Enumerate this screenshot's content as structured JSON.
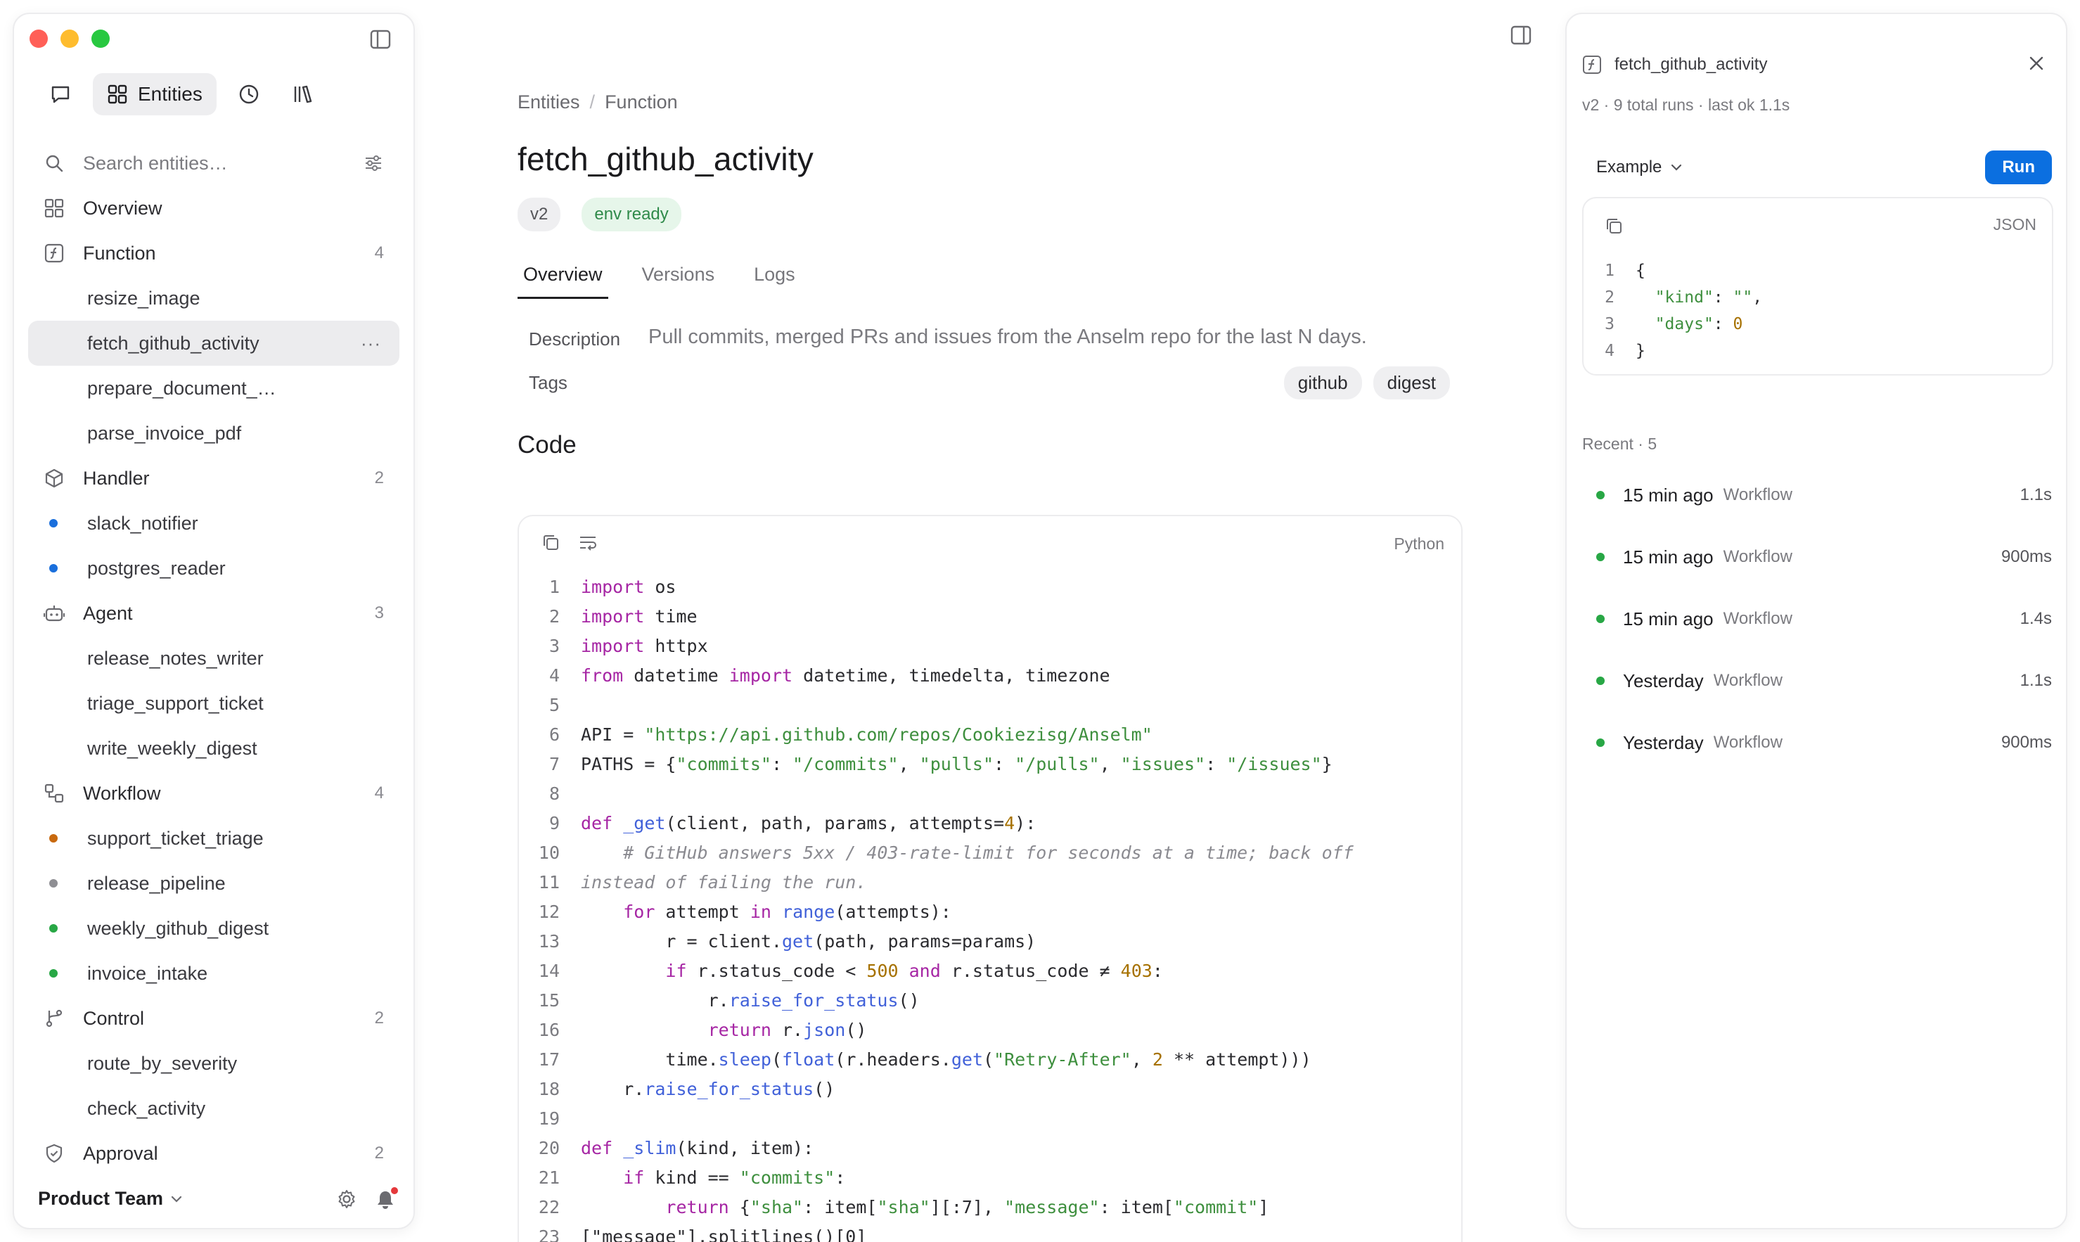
{
  "sidebar": {
    "mode_active_label": "Entities",
    "search_placeholder": "Search entities…",
    "overview_label": "Overview",
    "groups": [
      {
        "label": "Function",
        "count": "4",
        "icon": "function-icon",
        "items": [
          {
            "label": "resize_image"
          },
          {
            "label": "fetch_github_activity",
            "selected": true,
            "more": "···"
          },
          {
            "label": "prepare_document_…"
          },
          {
            "label": "parse_invoice_pdf"
          }
        ]
      },
      {
        "label": "Handler",
        "count": "2",
        "icon": "cube-icon",
        "items": [
          {
            "label": "slack_notifier",
            "dot": "#1a6fdc"
          },
          {
            "label": "postgres_reader",
            "dot": "#1a6fdc"
          }
        ]
      },
      {
        "label": "Agent",
        "count": "3",
        "icon": "bot-icon",
        "items": [
          {
            "label": "release_notes_writer"
          },
          {
            "label": "triage_support_ticket"
          },
          {
            "label": "write_weekly_digest"
          }
        ]
      },
      {
        "label": "Workflow",
        "count": "4",
        "icon": "workflow-icon",
        "items": [
          {
            "label": "support_ticket_triage",
            "dot": "#c8690f"
          },
          {
            "label": "release_pipeline",
            "dot": "#8e8e93"
          },
          {
            "label": "weekly_github_digest",
            "dot": "#28a745"
          },
          {
            "label": "invoice_intake",
            "dot": "#28a745"
          }
        ]
      },
      {
        "label": "Control",
        "count": "2",
        "icon": "branch-icon",
        "items": [
          {
            "label": "route_by_severity"
          },
          {
            "label": "check_activity"
          }
        ]
      },
      {
        "label": "Approval",
        "count": "2",
        "icon": "shield-check-icon",
        "items": []
      }
    ],
    "team_label": "Product Team"
  },
  "main": {
    "breadcrumb": [
      "Entities",
      "Function"
    ],
    "title": "fetch_github_activity",
    "badges": {
      "version": "v2",
      "env": "env ready"
    },
    "tabs": [
      "Overview",
      "Versions",
      "Logs"
    ],
    "description_label": "Description",
    "description": "Pull commits, merged PRs and issues from the Anselm repo for the last N days.",
    "tags_label": "Tags",
    "tags": [
      "github",
      "digest"
    ],
    "code_heading": "Code",
    "code_language": "Python",
    "code_lines": [
      [
        [
          "kw",
          "import"
        ],
        [
          "tx",
          " os"
        ]
      ],
      [
        [
          "kw",
          "import"
        ],
        [
          "tx",
          " time"
        ]
      ],
      [
        [
          "kw",
          "import"
        ],
        [
          "tx",
          " httpx"
        ]
      ],
      [
        [
          "kw",
          "from"
        ],
        [
          "tx",
          " datetime "
        ],
        [
          "kw",
          "import"
        ],
        [
          "tx",
          " datetime, timedelta, timezone"
        ]
      ],
      [],
      [
        [
          "tx",
          "API = "
        ],
        [
          "st",
          "\"https://api.github.com/repos/Cookiezisg/Anselm\""
        ]
      ],
      [
        [
          "tx",
          "PATHS = {"
        ],
        [
          "st",
          "\"commits\""
        ],
        [
          "tx",
          ": "
        ],
        [
          "st",
          "\"/commits\""
        ],
        [
          "tx",
          ", "
        ],
        [
          "st",
          "\"pulls\""
        ],
        [
          "tx",
          ": "
        ],
        [
          "st",
          "\"/pulls\""
        ],
        [
          "tx",
          ", "
        ],
        [
          "st",
          "\"issues\""
        ],
        [
          "tx",
          ": "
        ],
        [
          "st",
          "\"/issues\""
        ],
        [
          "tx",
          "}"
        ]
      ],
      [],
      [
        [
          "kw",
          "def"
        ],
        [
          "tx",
          " "
        ],
        [
          "fn",
          "_get"
        ],
        [
          "tx",
          "(client, path, params, attempts="
        ],
        [
          "nm",
          "4"
        ],
        [
          "tx",
          "):"
        ]
      ],
      [
        [
          "cm",
          "    # GitHub answers 5xx / 403-rate-limit for seconds at a time; back off"
        ]
      ],
      [
        [
          "cm",
          "instead of failing the run."
        ]
      ],
      [
        [
          "tx",
          "    "
        ],
        [
          "kw",
          "for"
        ],
        [
          "tx",
          " attempt "
        ],
        [
          "kw",
          "in"
        ],
        [
          "tx",
          " "
        ],
        [
          "fn",
          "range"
        ],
        [
          "tx",
          "(attempts):"
        ]
      ],
      [
        [
          "tx",
          "        r = client."
        ],
        [
          "fn",
          "get"
        ],
        [
          "tx",
          "(path, params=params)"
        ]
      ],
      [
        [
          "tx",
          "        "
        ],
        [
          "kw",
          "if"
        ],
        [
          "tx",
          " r.status_code < "
        ],
        [
          "nm",
          "500"
        ],
        [
          "tx",
          " "
        ],
        [
          "kw",
          "and"
        ],
        [
          "tx",
          " r.status_code ≠ "
        ],
        [
          "nm",
          "403"
        ],
        [
          "tx",
          ":"
        ]
      ],
      [
        [
          "tx",
          "            r."
        ],
        [
          "fn",
          "raise_for_status"
        ],
        [
          "tx",
          "()"
        ]
      ],
      [
        [
          "tx",
          "            "
        ],
        [
          "kw",
          "return"
        ],
        [
          "tx",
          " r."
        ],
        [
          "fn",
          "json"
        ],
        [
          "tx",
          "()"
        ]
      ],
      [
        [
          "tx",
          "        time."
        ],
        [
          "fn",
          "sleep"
        ],
        [
          "tx",
          "("
        ],
        [
          "fn",
          "float"
        ],
        [
          "tx",
          "(r.headers."
        ],
        [
          "fn",
          "get"
        ],
        [
          "tx",
          "("
        ],
        [
          "st",
          "\"Retry-After\""
        ],
        [
          "tx",
          ", "
        ],
        [
          "nm",
          "2"
        ],
        [
          "tx",
          " ** attempt)))"
        ]
      ],
      [
        [
          "tx",
          "    r."
        ],
        [
          "fn",
          "raise_for_status"
        ],
        [
          "tx",
          "()"
        ]
      ],
      [],
      [
        [
          "kw",
          "def"
        ],
        [
          "tx",
          " "
        ],
        [
          "fn",
          "_slim"
        ],
        [
          "tx",
          "(kind, item):"
        ]
      ],
      [
        [
          "tx",
          "    "
        ],
        [
          "kw",
          "if"
        ],
        [
          "tx",
          " kind == "
        ],
        [
          "st",
          "\"commits\""
        ],
        [
          "tx",
          ":"
        ]
      ],
      [
        [
          "tx",
          "        "
        ],
        [
          "kw",
          "return"
        ],
        [
          "tx",
          " {"
        ],
        [
          "st",
          "\"sha\""
        ],
        [
          "tx",
          ": item["
        ],
        [
          "st",
          "\"sha\""
        ],
        [
          "tx",
          "][:7], "
        ],
        [
          "st",
          "\"message\""
        ],
        [
          "tx",
          ": item["
        ],
        [
          "st",
          "\"commit\""
        ],
        [
          "tx",
          "]"
        ]
      ],
      [
        [
          "tx",
          "[\"message\"].splitlines()[0]"
        ]
      ]
    ]
  },
  "panel": {
    "title": "fetch_github_activity",
    "meta": "v2 · 9 total runs · last ok 1.1s",
    "example_label": "Example",
    "run_label": "Run",
    "json_label": "JSON",
    "json_lines": [
      [
        [
          "tx",
          "{"
        ]
      ],
      [
        [
          "tx",
          "  "
        ],
        [
          "st",
          "\"kind\""
        ],
        [
          "tx",
          ": "
        ],
        [
          "st",
          "\"\""
        ],
        [
          "tx",
          ","
        ]
      ],
      [
        [
          "tx",
          "  "
        ],
        [
          "st",
          "\"days\""
        ],
        [
          "tx",
          ": "
        ],
        [
          "nm",
          "0"
        ]
      ],
      [
        [
          "tx",
          "}"
        ]
      ]
    ],
    "recent_label": "Recent · 5",
    "runs": [
      {
        "when": "15 min ago",
        "kind": "Workflow",
        "duration": "1.1s"
      },
      {
        "when": "15 min ago",
        "kind": "Workflow",
        "duration": "900ms"
      },
      {
        "when": "15 min ago",
        "kind": "Workflow",
        "duration": "1.4s"
      },
      {
        "when": "Yesterday",
        "kind": "Workflow",
        "duration": "1.1s"
      },
      {
        "when": "Yesterday",
        "kind": "Workflow",
        "duration": "900ms"
      }
    ]
  }
}
